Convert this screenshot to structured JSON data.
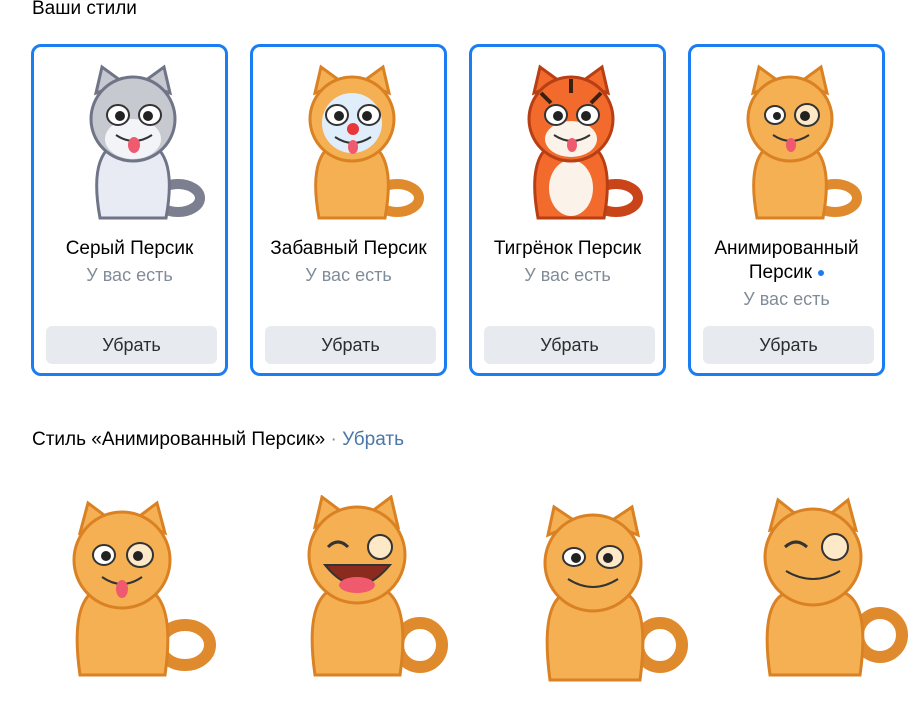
{
  "header": {
    "title": "Ваши стили"
  },
  "cards": [
    {
      "name": "Серый Персик",
      "owned": "У вас есть",
      "button": "Убрать"
    },
    {
      "name": "Забавный Персик",
      "owned": "У вас есть",
      "button": "Убрать"
    },
    {
      "name": "Тигрёнок Персик",
      "owned": "У вас есть",
      "button": "Убрать"
    },
    {
      "name_line1": "Анимированный",
      "name_line2": "Персик",
      "owned": "У вас есть",
      "button": "Убрать",
      "badge_color": "#1a7ef2"
    }
  ],
  "current_style": {
    "label": "Стиль «Анимированный Персик»",
    "separator": "·",
    "action": "Убрать"
  },
  "stickers": [
    "grin-tongue-cat",
    "laughing-cat",
    "smiling-cat",
    "content-cat"
  ],
  "colors": {
    "accent": "#1a7ef2",
    "secondary_text": "#818c99",
    "button_bg": "#e7ebf0",
    "link": "#4a76a8"
  }
}
